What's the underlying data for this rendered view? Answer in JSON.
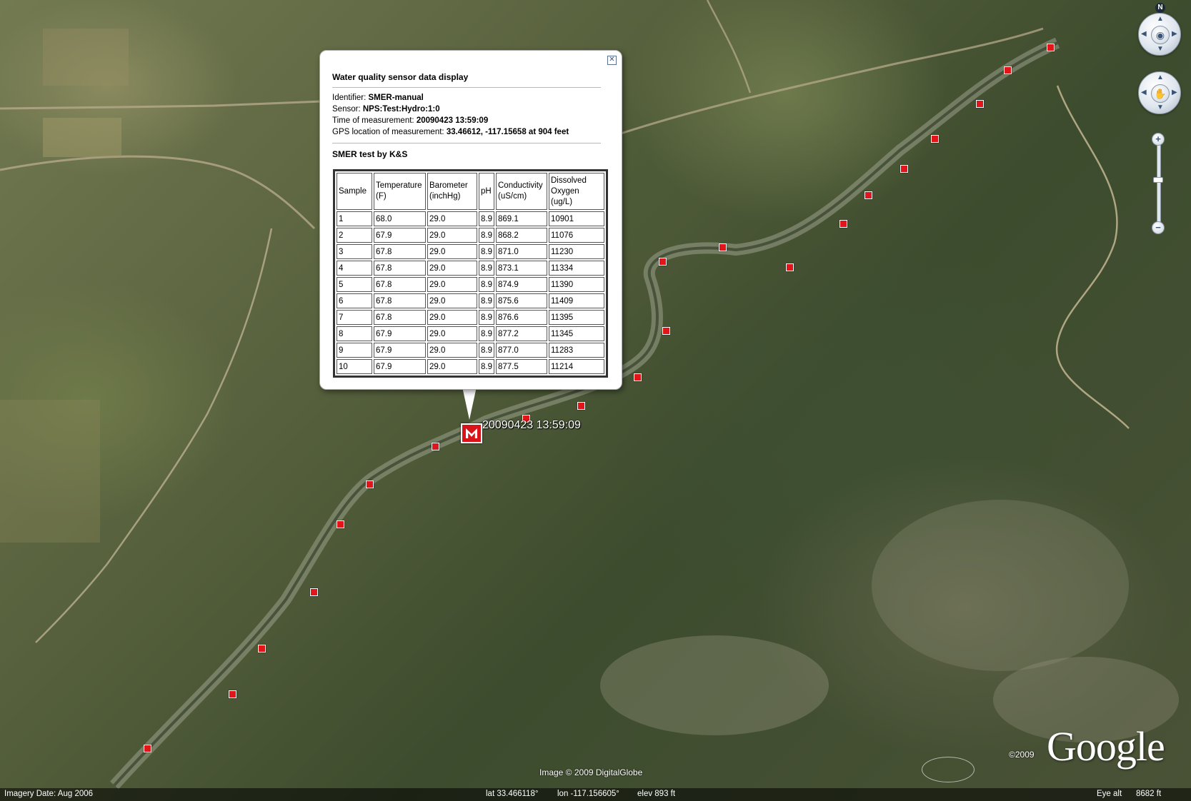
{
  "balloon": {
    "title": "Water quality sensor data display",
    "identifier_label": "Identifier:",
    "identifier_value": "SMER-manual",
    "sensor_label": "Sensor:",
    "sensor_value": "NPS:Test:Hydro:1:0",
    "time_label": "Time of measurement:",
    "time_value": "20090423 13:59:09",
    "gps_label": "GPS location of measurement:",
    "gps_value": "33.46612, -117.15658 at 904 feet",
    "subtitle": "SMER test by K&S",
    "table": {
      "headers": [
        "Sample",
        "Temperature (F)",
        "Barometer (inchHg)",
        "pH",
        "Conductivity (uS/cm)",
        "Dissolved Oxygen (ug/L)"
      ],
      "rows": [
        [
          "1",
          "68.0",
          "29.0",
          "8.9",
          "869.1",
          "10901"
        ],
        [
          "2",
          "67.9",
          "29.0",
          "8.9",
          "868.2",
          "11076"
        ],
        [
          "3",
          "67.8",
          "29.0",
          "8.9",
          "871.0",
          "11230"
        ],
        [
          "4",
          "67.8",
          "29.0",
          "8.9",
          "873.1",
          "11334"
        ],
        [
          "5",
          "67.8",
          "29.0",
          "8.9",
          "874.9",
          "11390"
        ],
        [
          "6",
          "67.8",
          "29.0",
          "8.9",
          "875.6",
          "11409"
        ],
        [
          "7",
          "67.8",
          "29.0",
          "8.9",
          "876.6",
          "11395"
        ],
        [
          "8",
          "67.9",
          "29.0",
          "8.9",
          "877.2",
          "11345"
        ],
        [
          "9",
          "67.9",
          "29.0",
          "8.9",
          "877.0",
          "11283"
        ],
        [
          "10",
          "67.9",
          "29.0",
          "8.9",
          "877.5",
          "11214"
        ]
      ]
    }
  },
  "active_marker": {
    "label": "20090423 13:59:09",
    "icon": "placemark-m-icon"
  },
  "navigation": {
    "north_label": "N",
    "look_icon": "eye-icon",
    "move_icon": "hand-icon",
    "zoom_in_label": "+",
    "zoom_out_label": "−"
  },
  "credits": {
    "image": "Image © 2009 DigitalGlobe",
    "year": "©2009",
    "logo": "Google"
  },
  "status": {
    "imagery_date": "Imagery Date: Aug 2006",
    "lat": "lat  33.466118°",
    "lon": "lon -117.156605°",
    "elev": "elev  893 ft",
    "eye_alt_label": "Eye alt",
    "eye_alt_value": "8682 ft"
  },
  "colors": {
    "marker": "#e0161a",
    "balloon_bg": "#ffffff"
  }
}
